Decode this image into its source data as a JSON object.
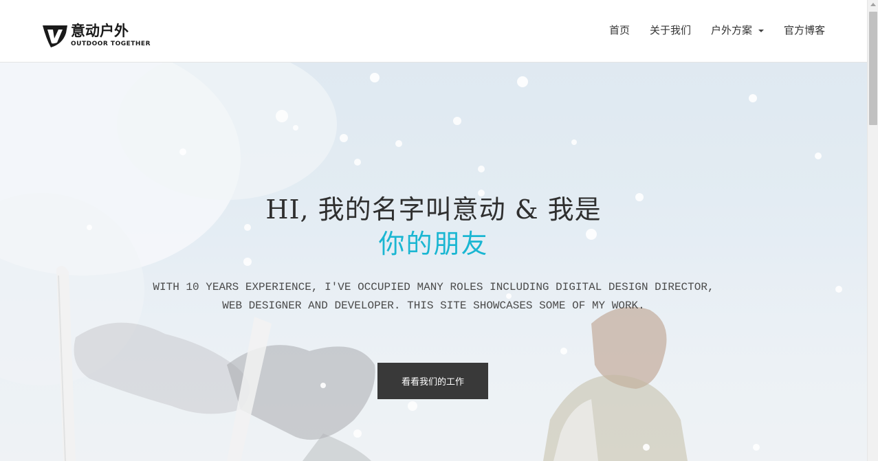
{
  "brand": {
    "name_cn": "意动户外",
    "name_en": "OUTDOOR TOGETHER"
  },
  "nav": {
    "items": [
      {
        "label": "首页"
      },
      {
        "label": "关于我们"
      },
      {
        "label": "户外方案",
        "has_dropdown": true
      },
      {
        "label": "官方博客"
      }
    ]
  },
  "hero": {
    "title": "HI, 我的名字叫意动 & 我是",
    "accent": "你的朋友",
    "description_line1": "WITH 10 YEARS EXPERIENCE, I'VE OCCUPIED MANY ROLES INCLUDING DIGITAL DESIGN DIRECTOR,",
    "description_line2": "WEB DESIGNER AND DEVELOPER. THIS SITE SHOWCASES SOME OF MY WORK.",
    "button_label": "看看我们的工作"
  },
  "colors": {
    "accent": "#1ab6d2",
    "button_bg": "#393939",
    "header_bg": "#ffffff"
  },
  "icons": {
    "logo": "outdoor-shield-logo-icon",
    "dropdown": "caret-down-icon"
  }
}
